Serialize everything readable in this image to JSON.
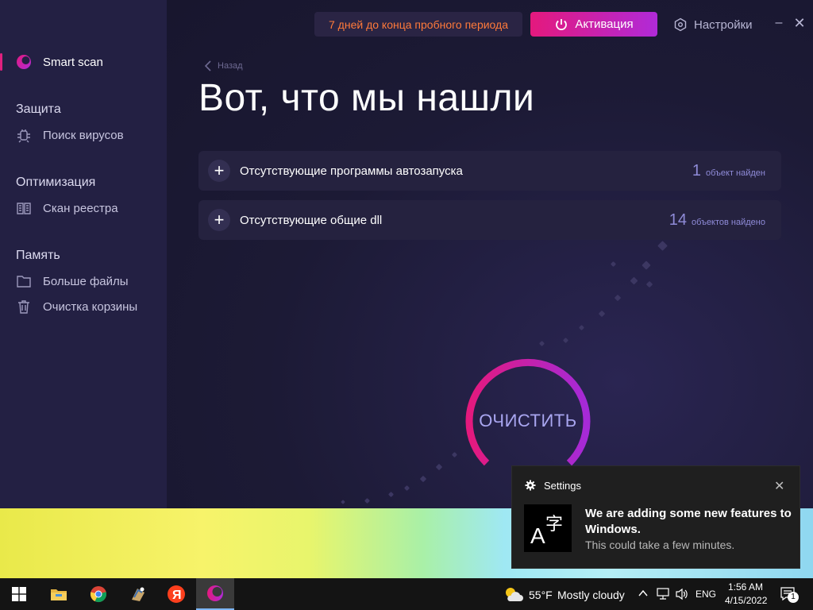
{
  "app": {
    "trial_notice": "7 дней до конца пробного периода",
    "activate_label": "Активация",
    "settings_label": "Настройки",
    "minimize_glyph": "–",
    "close_glyph": "✕",
    "colors": {
      "accent_pink": "#e4197d",
      "accent_purple": "#b02ad8",
      "trial_orange": "#ff7a3a",
      "count_blue": "#8f8bd8"
    }
  },
  "sidebar": {
    "smart_scan": "Smart scan",
    "groups": [
      {
        "label": "Защита",
        "items": [
          {
            "label": "Поиск вирусов",
            "icon": "bug-icon"
          }
        ]
      },
      {
        "label": "Оптимизация",
        "items": [
          {
            "label": "Скан реестра",
            "icon": "registry-book-icon"
          }
        ]
      },
      {
        "label": "Память",
        "items": [
          {
            "label": "Больше файлы",
            "icon": "folder-icon"
          },
          {
            "label": "Очистка корзины",
            "icon": "trash-icon"
          }
        ]
      }
    ]
  },
  "main": {
    "back_label": "Назад",
    "title": "Вот, что мы нашли",
    "results": [
      {
        "title": "Отсутствующие программы автозапуска",
        "count": "1",
        "unit": "объект найден"
      },
      {
        "title": "Отсутствующие общие dll",
        "count": "14",
        "unit": "объектов найдено"
      }
    ],
    "clean_label": "ОЧИСТИТЬ"
  },
  "taskbar": {
    "apps": [
      "windows-start-icon",
      "file-explorer-icon",
      "chrome-icon",
      "app-icon",
      "yandex-icon",
      "cleaner-app-icon"
    ],
    "weather": {
      "temp": "55°F",
      "condition": "Mostly cloudy"
    },
    "language": "ENG",
    "time": "1:56 AM",
    "date": "4/15/2022",
    "notification_count": "1"
  },
  "toast": {
    "app": "Settings",
    "title": "We are adding some new features to Windows.",
    "body": "This could take a few minutes."
  }
}
